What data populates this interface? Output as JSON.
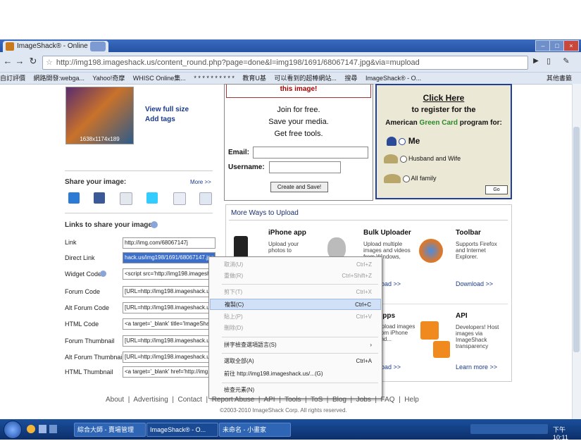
{
  "browser": {
    "tab_title": "ImageShack® - Online",
    "tab_close": "×",
    "url": "http://img198.imageshack.us/content_round.php?page=done&l=img198/1691/68067147.jpg&via=mupload",
    "bookmarks": [
      "自訂評價",
      "網路開發:webga...",
      "Yahoo!奇摩",
      "WHISC Online集...",
      "* * * * * * * * * *",
      "教育U基",
      "可以看到的超棒網站...",
      "搜尋",
      "ImageShack® - O...",
      "其他書籤"
    ]
  },
  "thumb": {
    "caption": "1638x1174x189"
  },
  "view": {
    "full_size": "View full size",
    "add_tags": "Add tags"
  },
  "share": {
    "title": "Share your image:",
    "more": "More >>"
  },
  "links": {
    "title": "Links to share your image:",
    "rows": [
      {
        "label": "Link",
        "value": "http://img.com/68067147j"
      },
      {
        "label": "Direct Link",
        "value": "hack.us/img198/1691/68067147.jpg"
      },
      {
        "label": "Widget Code",
        "value": "<script src='http://img198.imageshack.us"
      },
      {
        "label": "Forum Code",
        "value": "[URL=http://img198.imageshack.us/i/6806"
      },
      {
        "label": "Alt Forum Code",
        "value": "[URL=http://img198.imageshack.us/i/6806"
      },
      {
        "label": "HTML Code",
        "value": "<a target='_blank' title='ImageShack -"
      },
      {
        "label": "Forum Thumbnail",
        "value": "[URL=http://img198.imageshack.us/i/6806"
      },
      {
        "label": "Alt Forum Thumbnail",
        "value": "[URL=http://img198.imageshack.us/i/6806"
      },
      {
        "label": "HTML Thumbnail",
        "value": "<a target='_blank' href='http://img198"
      }
    ]
  },
  "signup": {
    "top_text": "this image!",
    "join1": "Join for free.",
    "join2": "Save your media.",
    "join3": "Get free tools.",
    "email_label": "Email:",
    "username_label": "Username:",
    "button": "Create and Save!"
  },
  "greencard": {
    "click_here": "Click Here",
    "line2": "to register for the",
    "line3a": "American",
    "line3b": "Green Card",
    "line3c": "program for:",
    "opt1": "Me",
    "opt2": "Husband and Wife",
    "opt3": "All family",
    "go": "Go"
  },
  "upload": {
    "title": "More Ways to Upload",
    "iphone_title": "iPhone app",
    "iphone_desc": "Upload your photos to",
    "bulk_title": "Bulk Uploader",
    "bulk_desc": "Upload multiple images and videos from Windows,",
    "bulk_link": "Download >>",
    "toolbar_title": "Toolbar",
    "toolbar_desc": "Supports Firefox and Internet Explorer.",
    "toolbar_link": "Download >>",
    "mid_title": "Apps",
    "mid_desc": "Upload images from iPhone and...",
    "mid_link": "Download >>",
    "api_title": "API",
    "api_desc": "Developers! Host images via ImageShack transparency",
    "api_link": "Learn more >>"
  },
  "context_menu": {
    "items": [
      {
        "label": "取消(U)",
        "shortcut": "Ctrl+Z",
        "disabled": true
      },
      {
        "label": "重做(R)",
        "shortcut": "Ctrl+Shift+Z",
        "disabled": true
      },
      {
        "label": "剪下(T)",
        "shortcut": "Ctrl+X",
        "disabled": true
      },
      {
        "label": "複製(C)",
        "shortcut": "Ctrl+C",
        "disabled": false
      },
      {
        "label": "貼上(P)",
        "shortcut": "Ctrl+V",
        "disabled": true
      },
      {
        "label": "刪除(D)",
        "shortcut": "",
        "disabled": true
      },
      {
        "label": "拼字檢查選項語言(S)",
        "shortcut": "›",
        "disabled": false
      },
      {
        "label": "選取全部(A)",
        "shortcut": "Ctrl+A",
        "disabled": false
      },
      {
        "label": "前往 http://img198.imageshack.us/...(G)",
        "shortcut": "",
        "disabled": false
      },
      {
        "label": "檢查元素(N)",
        "shortcut": "",
        "disabled": false
      }
    ]
  },
  "footer": {
    "links": [
      "About",
      "Advertising",
      "Contact",
      "Report Abuse",
      "API",
      "Tools",
      "ToS",
      "Blog",
      "Jobs",
      "FAQ",
      "Help"
    ],
    "copyright": "©2003-2010 ImageShack Corp. All rights reserved."
  },
  "taskbar": {
    "tasks": [
      "綜合大師 - 賣場管理",
      "ImageShack® - O...",
      "未命名 - 小畫家"
    ],
    "clock": "下午 10:11"
  }
}
